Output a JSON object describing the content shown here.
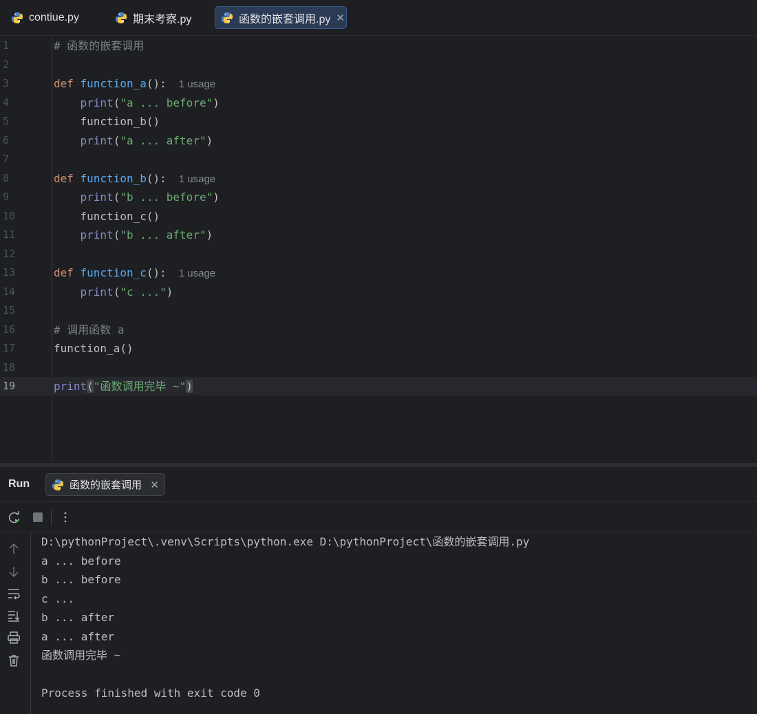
{
  "tabs": [
    {
      "label": "contiue.py",
      "active": false
    },
    {
      "label": "期末考察.py",
      "active": false
    },
    {
      "label": "函数的嵌套调用.py",
      "active": true
    }
  ],
  "editor": {
    "lines": [
      {
        "n": "1",
        "tokens": [
          {
            "t": "# 函数的嵌套调用",
            "c": "cm"
          }
        ]
      },
      {
        "n": "2",
        "tokens": []
      },
      {
        "n": "3",
        "tokens": [
          {
            "t": "def ",
            "c": "kw"
          },
          {
            "t": "function_a",
            "c": "fn"
          },
          {
            "t": "():",
            "c": ""
          }
        ],
        "hint": "1 usage"
      },
      {
        "n": "4",
        "tokens": [
          {
            "t": "    "
          },
          {
            "t": "print",
            "c": "bi"
          },
          {
            "t": "("
          },
          {
            "t": "\"a ... before\"",
            "c": "str"
          },
          {
            "t": ")"
          }
        ]
      },
      {
        "n": "5",
        "tokens": [
          {
            "t": "    function_b()"
          }
        ]
      },
      {
        "n": "6",
        "tokens": [
          {
            "t": "    "
          },
          {
            "t": "print",
            "c": "bi"
          },
          {
            "t": "("
          },
          {
            "t": "\"a ... after\"",
            "c": "str"
          },
          {
            "t": ")"
          }
        ]
      },
      {
        "n": "7",
        "tokens": []
      },
      {
        "n": "8",
        "tokens": [
          {
            "t": "def ",
            "c": "kw"
          },
          {
            "t": "function_b",
            "c": "fn"
          },
          {
            "t": "():",
            "c": ""
          }
        ],
        "hint": "1 usage"
      },
      {
        "n": "9",
        "tokens": [
          {
            "t": "    "
          },
          {
            "t": "print",
            "c": "bi"
          },
          {
            "t": "("
          },
          {
            "t": "\"b ... before\"",
            "c": "str"
          },
          {
            "t": ")"
          }
        ]
      },
      {
        "n": "10",
        "tokens": [
          {
            "t": "    function_c()"
          }
        ]
      },
      {
        "n": "11",
        "tokens": [
          {
            "t": "    "
          },
          {
            "t": "print",
            "c": "bi"
          },
          {
            "t": "("
          },
          {
            "t": "\"b ... after\"",
            "c": "str"
          },
          {
            "t": ")"
          }
        ]
      },
      {
        "n": "12",
        "tokens": []
      },
      {
        "n": "13",
        "tokens": [
          {
            "t": "def ",
            "c": "kw"
          },
          {
            "t": "function_c",
            "c": "fn"
          },
          {
            "t": "():",
            "c": ""
          }
        ],
        "hint": "1 usage"
      },
      {
        "n": "14",
        "tokens": [
          {
            "t": "    "
          },
          {
            "t": "print",
            "c": "bi"
          },
          {
            "t": "("
          },
          {
            "t": "\"c ...\"",
            "c": "str"
          },
          {
            "t": ")"
          }
        ]
      },
      {
        "n": "15",
        "tokens": []
      },
      {
        "n": "16",
        "tokens": [
          {
            "t": "# 调用函数 a",
            "c": "cm"
          }
        ]
      },
      {
        "n": "17",
        "tokens": [
          {
            "t": "function_a()"
          }
        ]
      },
      {
        "n": "18",
        "tokens": []
      },
      {
        "n": "19",
        "tokens": [
          {
            "t": "print",
            "c": "bi"
          },
          {
            "t": "(",
            "c": "paren-hl"
          },
          {
            "t": "\"函数调用完毕 ~\"",
            "c": "str"
          },
          {
            "t": ")",
            "c": "paren-hl"
          }
        ],
        "current": true
      }
    ]
  },
  "run": {
    "title": "Run",
    "tab_label": "函数的嵌套调用",
    "console": [
      "D:\\pythonProject\\.venv\\Scripts\\python.exe D:\\pythonProject\\函数的嵌套调用.py",
      "a ... before",
      "b ... before",
      "c ...",
      "b ... after",
      "a ... after",
      "函数调用完毕 ~",
      "",
      "Process finished with exit code 0"
    ]
  },
  "icons": {
    "file_type": "python-icon",
    "toolbar": [
      "rerun-icon",
      "stop-icon",
      "more-options-icon"
    ],
    "side": [
      "scroll-up-icon",
      "scroll-down-icon",
      "soft-wrap-icon",
      "scroll-to-end-icon",
      "print-icon",
      "trash-icon"
    ]
  }
}
